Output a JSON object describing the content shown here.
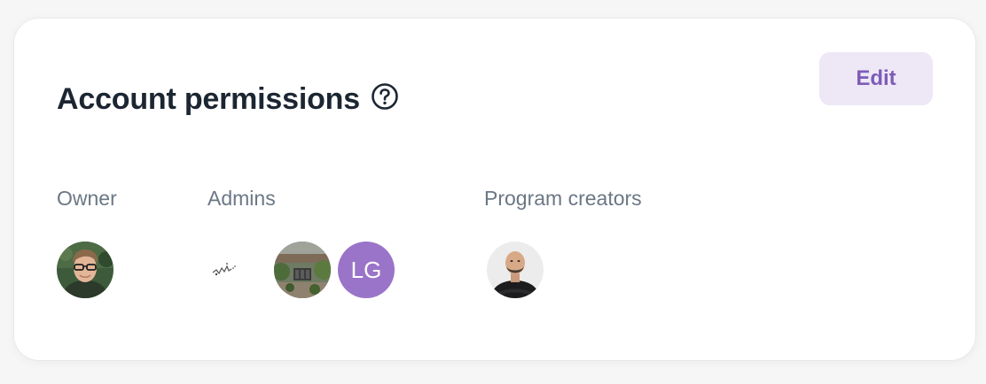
{
  "card": {
    "title": "Account permissions",
    "help_icon": "question-circle-icon",
    "edit_label": "Edit"
  },
  "groups": {
    "owner": {
      "label": "Owner",
      "members": [
        {
          "type": "photo",
          "desc": "man-with-glasses"
        }
      ]
    },
    "admins": {
      "label": "Admins",
      "members": [
        {
          "type": "photo",
          "desc": "signature-sketch"
        },
        {
          "type": "photo",
          "desc": "garden-scene"
        },
        {
          "type": "initials",
          "initials": "LG"
        }
      ]
    },
    "program_creators": {
      "label": "Program creators",
      "members": [
        {
          "type": "photo",
          "desc": "bald-man-arms-crossed"
        }
      ]
    }
  },
  "colors": {
    "accent": "#7e5cb8",
    "button_bg": "#ede7f6",
    "initials_bg": "#9a74c8",
    "title": "#1c2632",
    "label": "#6b7785"
  }
}
